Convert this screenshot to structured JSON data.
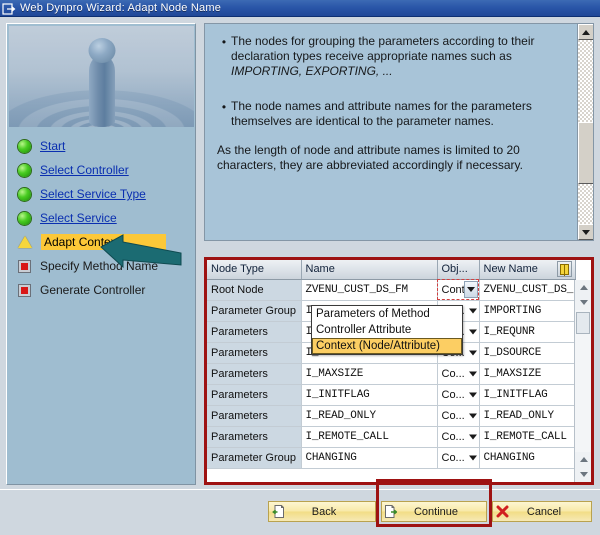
{
  "window": {
    "title": "Web Dynpro Wizard: Adapt Node Name",
    "icon": "window-document-icon"
  },
  "sidebar": {
    "image_alt": "water-droplet-ripple-image",
    "steps": [
      {
        "label": "Start",
        "state": "done",
        "icon": "green-circle-icon"
      },
      {
        "label": "Select Controller",
        "state": "done",
        "icon": "green-circle-icon"
      },
      {
        "label": "Select Service Type",
        "state": "done",
        "icon": "green-circle-icon"
      },
      {
        "label": "Select Service",
        "state": "done",
        "icon": "green-circle-icon"
      },
      {
        "label": "Adapt Context",
        "state": "current",
        "icon": "yellow-triangle-icon"
      },
      {
        "label": "Specify Method Name",
        "state": "todo",
        "icon": "red-square-icon"
      },
      {
        "label": "Generate Controller",
        "state": "todo",
        "icon": "red-square-icon"
      }
    ]
  },
  "instructions": {
    "bullets": [
      "The nodes for grouping the parameters according to their declaration types receive appropriate names such as ",
      "The node names and attribute names for the parameters themselves are identical to the parameter names."
    ],
    "bullet1_italic": "IMPORTING, EXPORTING, ...",
    "paragraph": "As the length of node and attribute names is limited to 20 characters, they are abbreviated accordingly if necessary.",
    "bullet_glyph": "•"
  },
  "table": {
    "columns": [
      "Node Type",
      "Name",
      "Obj...",
      "New Name"
    ],
    "column_config_icon": "column-settings-icon",
    "rows": [
      {
        "node_type": "Root Node",
        "name": "ZVENU_CUST_DS_FM",
        "obj": "Cont",
        "new_name": "ZVENU_CUST_DS_FM",
        "focused": true
      },
      {
        "node_type": "Parameter Group",
        "name": "IMPORTING",
        "obj": "Co...",
        "new_name": "IMPORTING",
        "focused": false
      },
      {
        "node_type": "Parameters",
        "name": "I_REQUNR",
        "obj": "Co...",
        "new_name": "I_REQUNR",
        "focused": false
      },
      {
        "node_type": "Parameters",
        "name": "I_DSOURCE",
        "obj": "Co...",
        "new_name": "I_DSOURCE",
        "focused": false
      },
      {
        "node_type": "Parameters",
        "name": "I_MAXSIZE",
        "obj": "Co...",
        "new_name": "I_MAXSIZE",
        "focused": false
      },
      {
        "node_type": "Parameters",
        "name": "I_INITFLAG",
        "obj": "Co...",
        "new_name": "I_INITFLAG",
        "focused": false
      },
      {
        "node_type": "Parameters",
        "name": "I_READ_ONLY",
        "obj": "Co...",
        "new_name": "I_READ_ONLY",
        "focused": false
      },
      {
        "node_type": "Parameters",
        "name": "I_REMOTE_CALL",
        "obj": "Co...",
        "new_name": "I_REMOTE_CALL",
        "focused": false
      },
      {
        "node_type": "Parameter Group",
        "name": "CHANGING",
        "obj": "Co...",
        "new_name": "CHANGING",
        "focused": false
      }
    ]
  },
  "dropdown": {
    "options": [
      {
        "label": "Parameters of Method",
        "selected": false
      },
      {
        "label": "Controller Attribute",
        "selected": false
      },
      {
        "label": "Context (Node/Attribute)",
        "selected": true
      }
    ]
  },
  "footer": {
    "back": {
      "label": "Back",
      "icon": "back-document-icon"
    },
    "continue": {
      "label": "Continue",
      "icon": "continue-document-icon"
    },
    "cancel": {
      "label": "Cancel",
      "icon": "red-x-icon"
    }
  },
  "annotations": {
    "arrow_color": "#1b6b72",
    "highlight_color": "#9e1212",
    "highlight_targets": [
      "table",
      "continue-button"
    ]
  },
  "colors": {
    "titlebar": "#2a56a8",
    "sidebar_bg": "#9fbdd0",
    "instructions_bg": "#a8c4d8",
    "dialog_bg": "#cfd7df",
    "active_step": "#fcc838",
    "dropdown_selected": "#fcce63",
    "button_face": "#f8e9a8"
  }
}
